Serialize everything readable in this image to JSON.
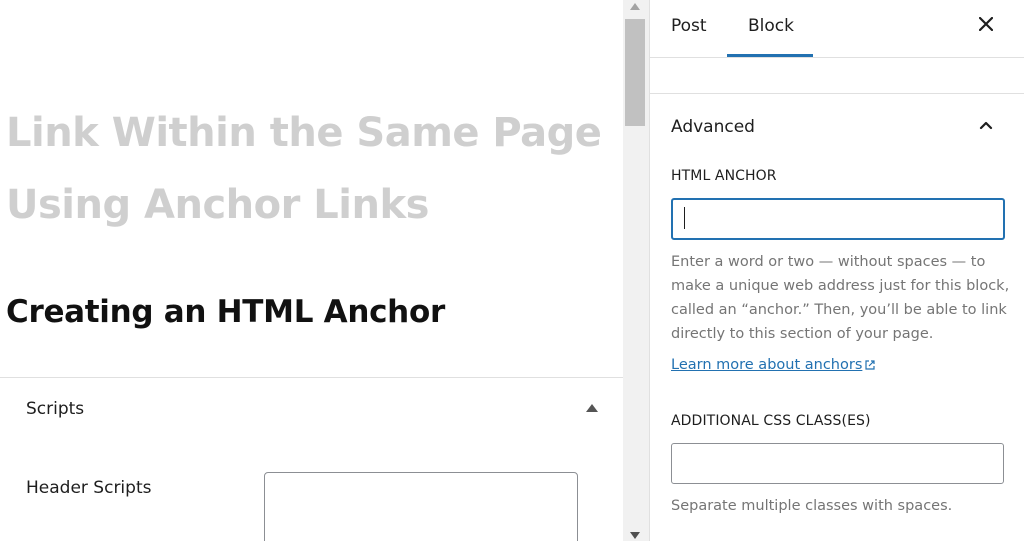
{
  "editor": {
    "title": "Link Within the Same Page Using Anchor Links",
    "heading": "Creating an HTML Anchor"
  },
  "metabox": {
    "title": "Scripts",
    "header_scripts_label": "Header Scripts"
  },
  "sidebar": {
    "tabs": [
      {
        "label": "Post"
      },
      {
        "label": "Block"
      }
    ],
    "active_tab": "Block",
    "close_icon": "close-icon",
    "panel": {
      "title": "Advanced",
      "html_anchor": {
        "label": "HTML ANCHOR",
        "value": "",
        "help": "Enter a word or two — without spaces — to make a unique web address just for this block, called an “anchor.” Then, you’ll be able to link directly to this section of your page.",
        "learn_more": "Learn more about anchors"
      },
      "css_class": {
        "label": "ADDITIONAL CSS CLASS(ES)",
        "value": "",
        "help": "Separate multiple classes with spaces."
      }
    }
  },
  "colors": {
    "accent": "#2271b1",
    "muted_text": "#757575",
    "faded_title": "#cfcfcf"
  }
}
